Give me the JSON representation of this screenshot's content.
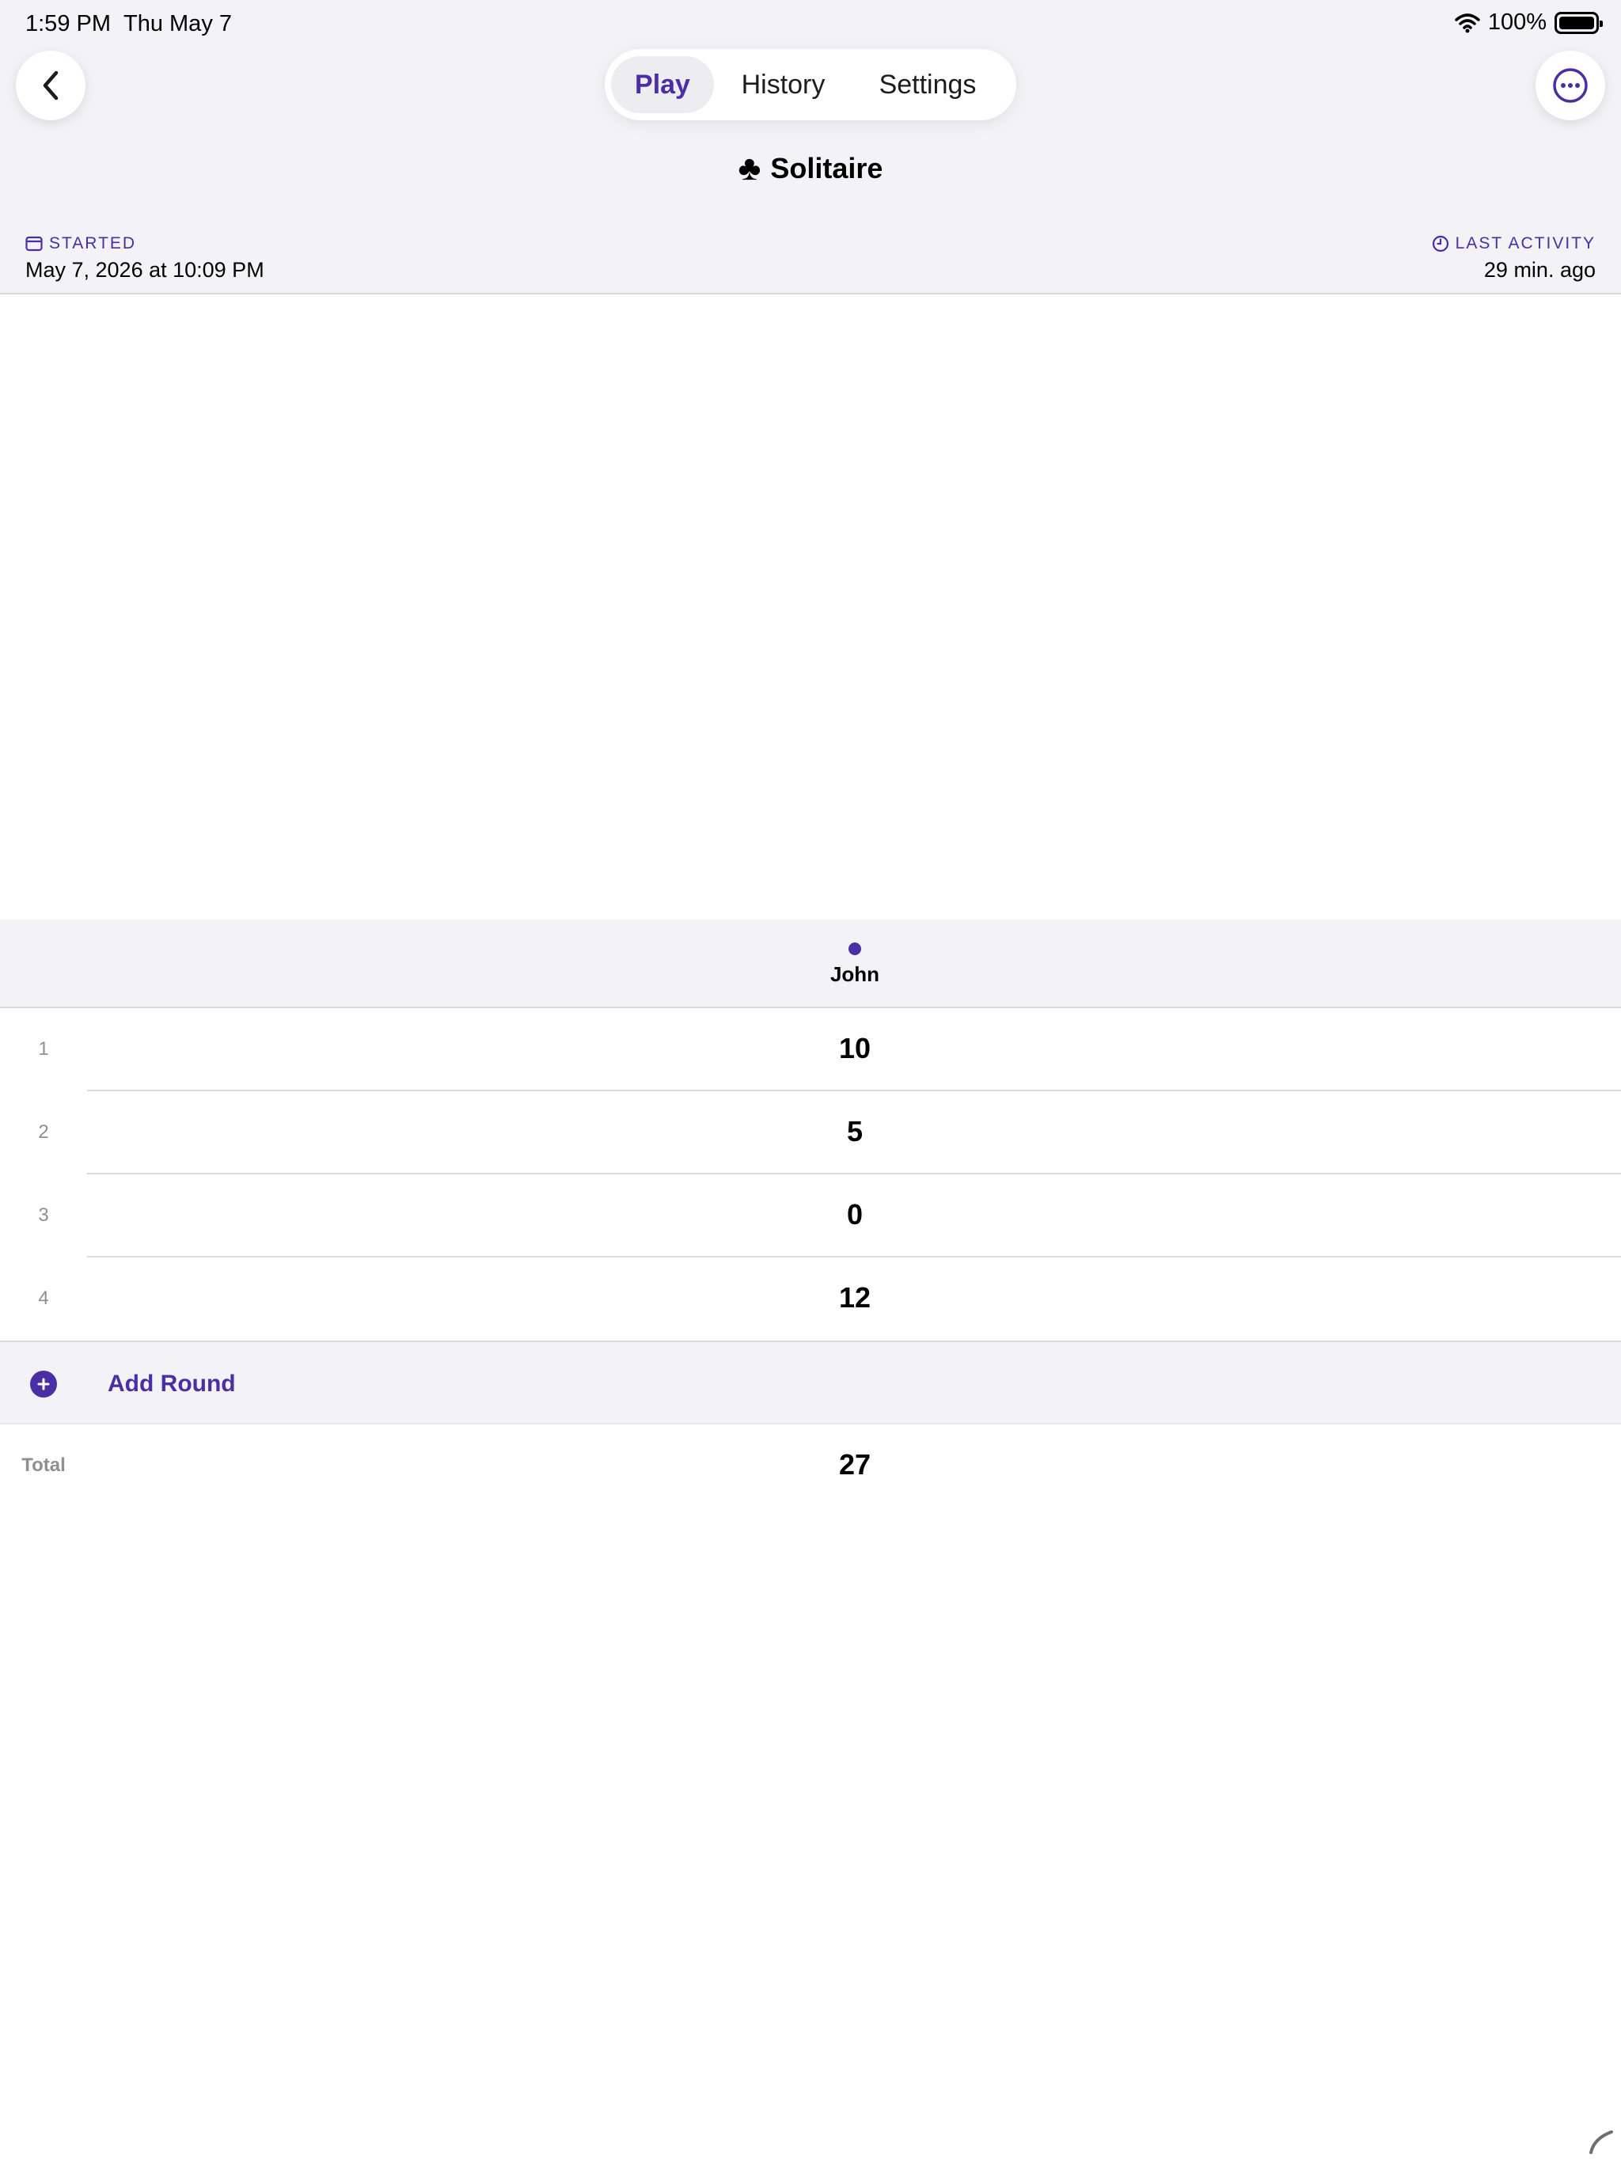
{
  "status_bar": {
    "time": "1:59 PM",
    "date": "Thu May 7",
    "battery": "100%"
  },
  "tabs": [
    {
      "label": "Play",
      "active": true
    },
    {
      "label": "History",
      "active": false
    },
    {
      "label": "Settings",
      "active": false
    }
  ],
  "game": {
    "icon": "♣",
    "title": "Solitaire"
  },
  "meta": {
    "started_label": "STARTED",
    "started_value": "May 7, 2026 at 10:09 PM",
    "activity_label": "LAST ACTIVITY",
    "activity_value": "29 min. ago"
  },
  "player": {
    "name": "John",
    "color": "#4b2ea3"
  },
  "rounds": [
    {
      "number": "1",
      "score": "10"
    },
    {
      "number": "2",
      "score": "5"
    },
    {
      "number": "3",
      "score": "0"
    },
    {
      "number": "4",
      "score": "12"
    }
  ],
  "add_round_label": "Add Round",
  "total": {
    "label": "Total",
    "value": "27"
  },
  "colors": {
    "accent": "#4b2ea3",
    "background": "#f2f2f7"
  }
}
